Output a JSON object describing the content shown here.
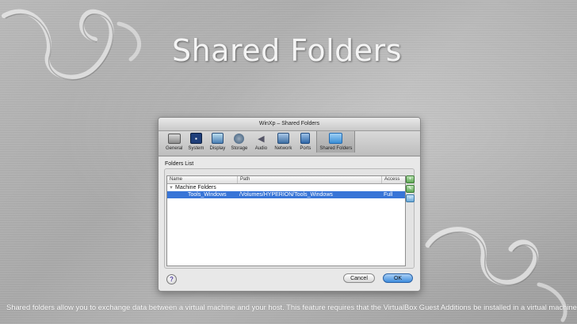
{
  "slide": {
    "title": "Shared Folders",
    "caption": "Shared folders allow you to exchange data between a virtual machine and your host. This feature requires that the VirtualBox Guest Additions be installed in a virtual machine."
  },
  "dialog": {
    "window_title": "WinXp – Shared Folders",
    "toolbar": [
      {
        "label": "General",
        "icon": "general-icon"
      },
      {
        "label": "System",
        "icon": "system-icon"
      },
      {
        "label": "Display",
        "icon": "display-icon"
      },
      {
        "label": "Storage",
        "icon": "storage-icon"
      },
      {
        "label": "Audio",
        "icon": "audio-icon"
      },
      {
        "label": "Network",
        "icon": "network-icon"
      },
      {
        "label": "Ports",
        "icon": "ports-icon"
      },
      {
        "label": "Shared Folders",
        "icon": "shared-folders-icon",
        "selected": true
      }
    ],
    "group_label": "Folders List",
    "table": {
      "headers": {
        "name": "Name",
        "path": "Path",
        "access": "Access"
      },
      "group_row": "Machine Folders",
      "rows": [
        {
          "name": "Tools_Windows",
          "path": "/Volumes/HYPERION/Tools_Windows",
          "access": "Full",
          "selected": true
        }
      ]
    },
    "buttons": {
      "help": "?",
      "cancel": "Cancel",
      "ok": "OK"
    }
  }
}
